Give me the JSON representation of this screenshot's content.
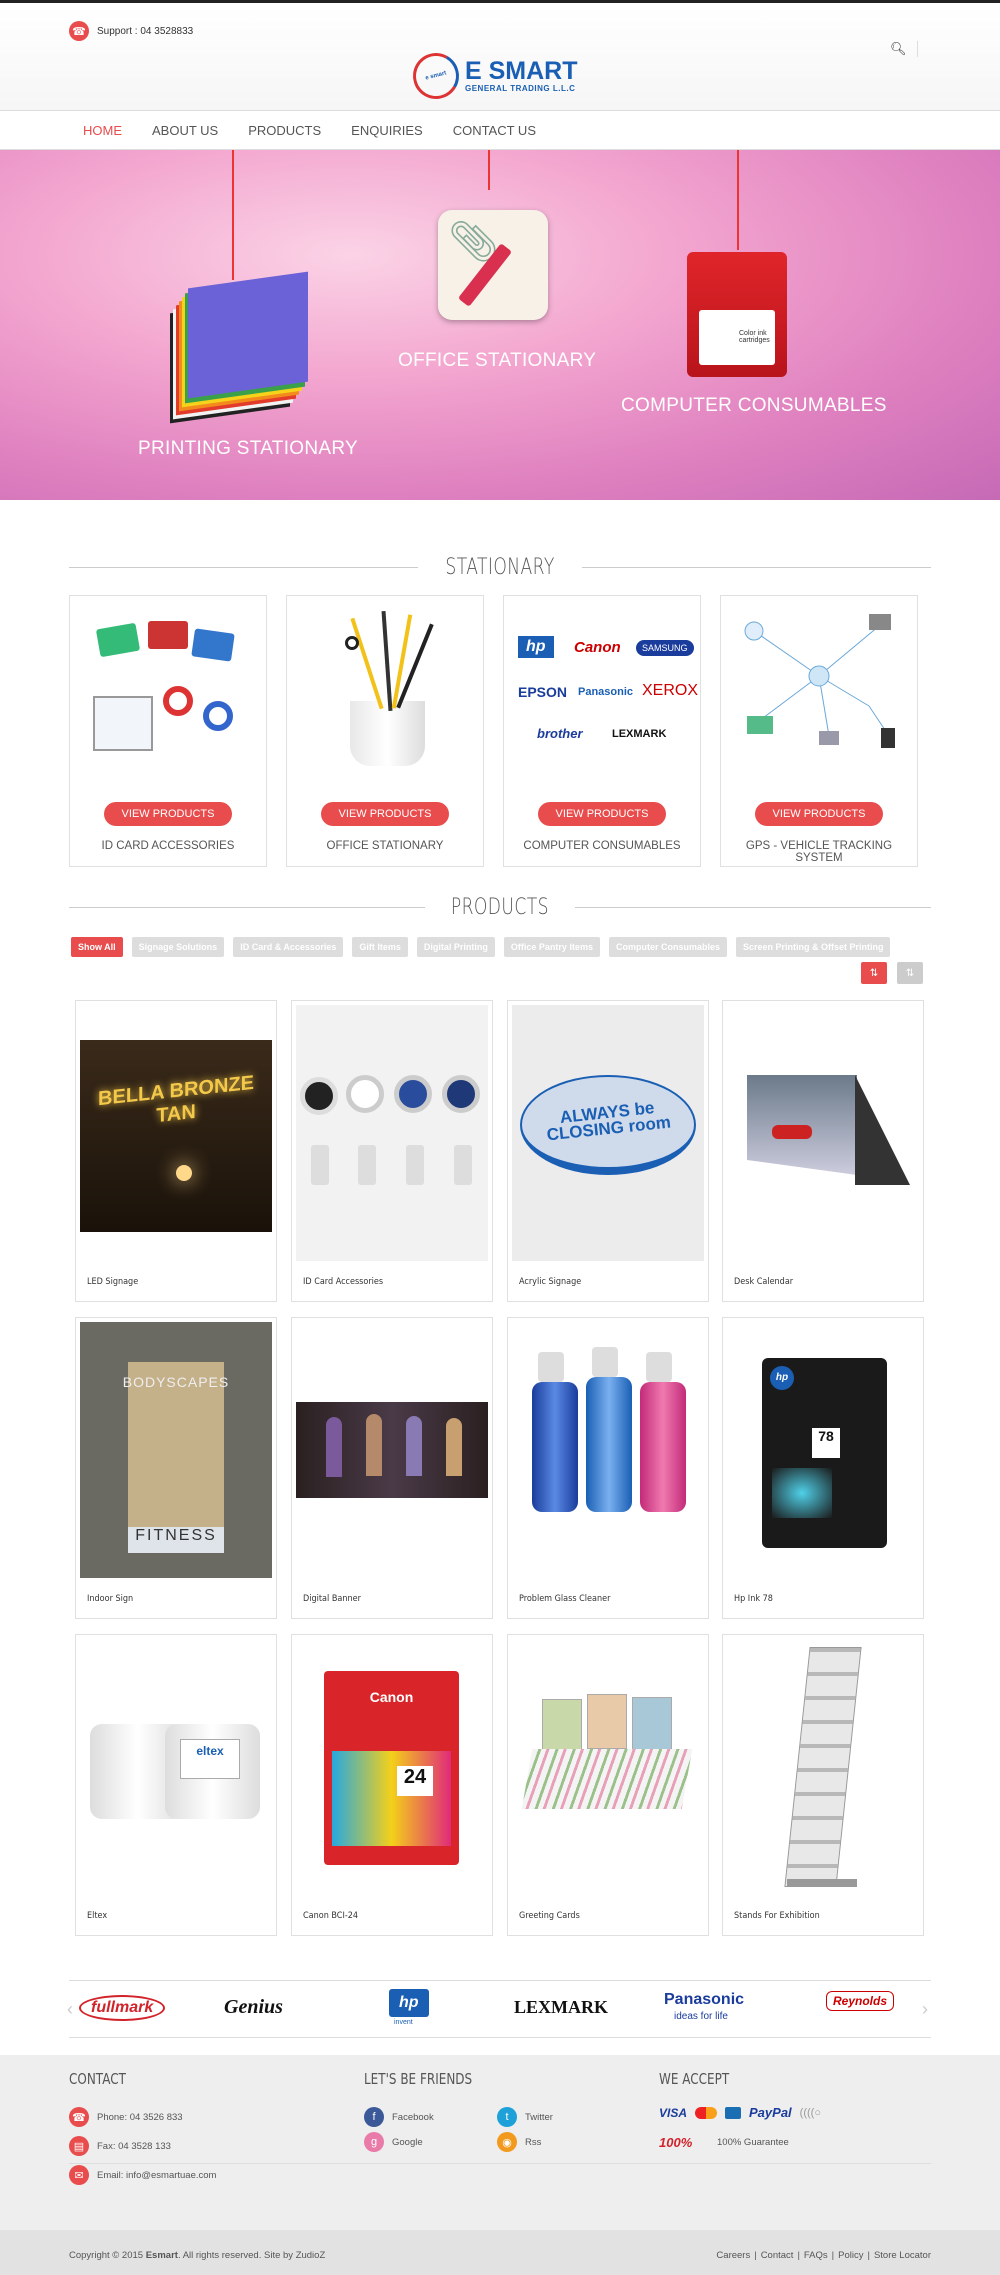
{
  "header": {
    "support_text": "Support : 04 3528833",
    "logo_main": "E SMART",
    "logo_sub": "GENERAL TRADING L.L.C",
    "logo_badge": "e smart"
  },
  "nav": {
    "items": [
      {
        "label": "HOME",
        "active": true
      },
      {
        "label": "ABOUT US"
      },
      {
        "label": "PRODUCTS"
      },
      {
        "label": "ENQUIRIES"
      },
      {
        "label": "CONTACT US"
      }
    ]
  },
  "hero": {
    "captions": [
      "PRINTING STATIONARY",
      "OFFICE STATIONARY",
      "COMPUTER CONSUMABLES"
    ],
    "ink_label": "Color ink cartridges"
  },
  "stationary": {
    "title": "STATIONARY",
    "button_label": "VIEW PRODUCTS",
    "cards": [
      {
        "name": "ID CARD ACCESSORIES"
      },
      {
        "name": "OFFICE STATIONARY"
      },
      {
        "name": "COMPUTER CONSUMABLES"
      },
      {
        "name": "GPS - VEHICLE TRACKING SYSTEM"
      }
    ],
    "card3_brands": [
      "hp",
      "Canon",
      "SAMSUNG",
      "EPSON",
      "Panasonic",
      "XEROX",
      "brother",
      "LEXMARK"
    ]
  },
  "products": {
    "title": "PRODUCTS",
    "filters": [
      "Show All",
      "Signage Solutions",
      "ID Card & Accessories",
      "Gift Items",
      "Digital Printing",
      "Office Pantry Items",
      "Computer Consumables",
      "Screen Printing & Offset Printing"
    ],
    "items": [
      {
        "name": "LED Signage",
        "img_text": "BELLA BRONZE TAN"
      },
      {
        "name": "ID Card Accessories"
      },
      {
        "name": "Acrylic Signage",
        "img_text": "ALWAYS be CLOSING room"
      },
      {
        "name": "Desk Calendar"
      },
      {
        "name": "Indoor Sign",
        "img_text": "BODYSCAPES",
        "img_text2": "FITNESS"
      },
      {
        "name": "Digital Banner"
      },
      {
        "name": "Problem Glass Cleaner"
      },
      {
        "name": "Hp Ink 78",
        "img_text": "78"
      },
      {
        "name": "Eltex",
        "img_text": "eltex"
      },
      {
        "name": "Canon BCI-24",
        "img_text": "Canon",
        "img_text2": "24"
      },
      {
        "name": "Greeting Cards"
      },
      {
        "name": "Stands For Exhibition"
      }
    ]
  },
  "brands": [
    "fullmark",
    "Genius",
    "hp",
    "LEXMARK",
    "Panasonic",
    "Reynolds"
  ],
  "brand_sub": {
    "hp": "invent",
    "panasonic": "ideas for life"
  },
  "footer": {
    "contact_title": "CONTACT",
    "phone": "Phone: 04 3526 833",
    "fax": "Fax: 04 3528 133",
    "email": "Email: info@esmartuae.com",
    "social_title": "LET'S BE FRIENDS",
    "facebook": "Facebook",
    "twitter": "Twitter",
    "google": "Google",
    "rss": "Rss",
    "accept_title": "WE ACCEPT",
    "guarantee": "100% Guarantee",
    "guarantee_badge": "100%"
  },
  "copyright": {
    "prefix": "Copyright © 2015 ",
    "brand": "Esmart",
    "suffix": ". All rights reserved. Site by ",
    "by": "ZudioZ",
    "links": [
      "Careers",
      "Contact",
      "FAQs",
      "Policy",
      "Store Locator"
    ]
  },
  "colors": {
    "accent": "#e84c4c",
    "brand_blue": "#1a5fb4",
    "footer_bg": "#eeeeee"
  }
}
